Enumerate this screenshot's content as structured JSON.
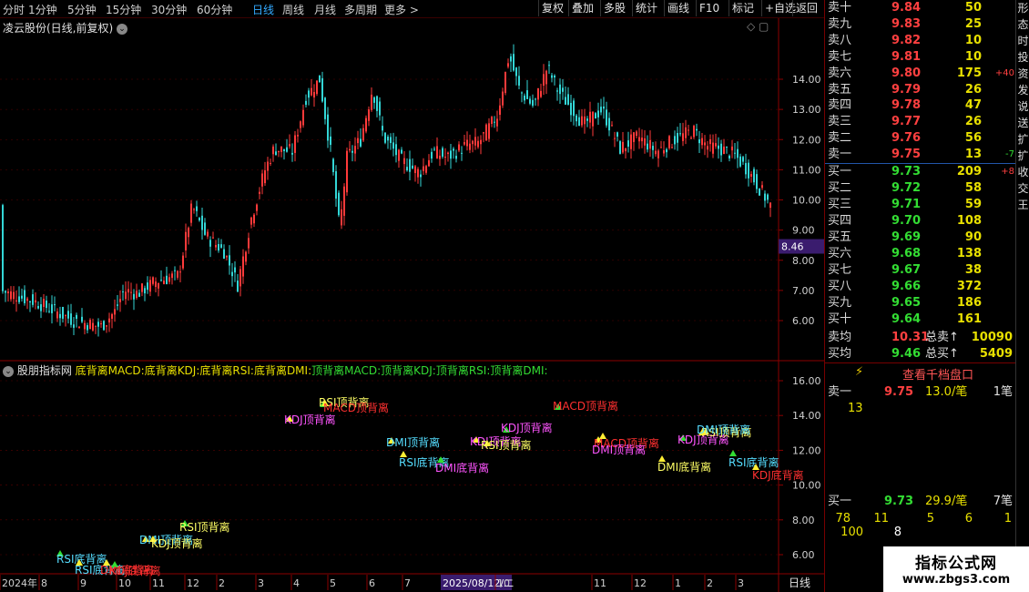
{
  "toolbar": {
    "periods": [
      "分时",
      "1分钟",
      "5分钟",
      "15分钟",
      "30分钟",
      "60分钟",
      "日线",
      "周线",
      "月线",
      "多周期",
      "更多 >"
    ],
    "active_index": 6,
    "right_buttons": [
      "复权",
      "叠加",
      "多股",
      "统计",
      "画线",
      "F10",
      "标记",
      "+自选",
      "返回"
    ]
  },
  "chart_header": {
    "stock_title": "凌云股份(日线,前复权)",
    "current_price_tag": "8.46"
  },
  "indicator_header": {
    "name": "股朋指标网",
    "legend": [
      {
        "text": "底背离MACD:",
        "color": "#e8e000"
      },
      {
        "text": "底背离KDJ:",
        "color": "#e8e000"
      },
      {
        "text": "底背离RSI:",
        "color": "#e8e000"
      },
      {
        "text": "底背离DMI:",
        "color": "#e8e000"
      },
      {
        "text": "顶背离MACD:",
        "color": "#33dd33"
      },
      {
        "text": "顶背离KDJ:",
        "color": "#33dd33"
      },
      {
        "text": "顶背离RSI:",
        "color": "#33dd33"
      },
      {
        "text": "顶背离DMI:",
        "color": "#33dd33"
      }
    ]
  },
  "price_axis": [
    "14.00",
    "13.00",
    "12.00",
    "11.00",
    "10.00",
    "9.00",
    "8.00",
    "7.00",
    "6.00"
  ],
  "indicator_axis": [
    "16.00",
    "14.00",
    "12.00",
    "10.00",
    "8.00",
    "6.00"
  ],
  "date_axis": {
    "labels": [
      "2024年",
      "8",
      "9",
      "10",
      "11",
      "12",
      "2",
      "3",
      "4",
      "5",
      "6",
      "7",
      "2025/08/12/二",
      "10",
      "11",
      "12",
      "1",
      "2",
      "3"
    ],
    "period_label": "日线"
  },
  "divergence_labels": [
    {
      "text": "RSI顶背离",
      "color": "#ffff66"
    },
    {
      "text": "MACD顶背离",
      "color": "#ff3030"
    },
    {
      "text": "KDJ顶背离",
      "color": "#ff55ff"
    },
    {
      "text": "MACD顶背离",
      "color": "#ff3030"
    },
    {
      "text": "DMI顶背离",
      "color": "#55ddff"
    },
    {
      "text": "RSI底背离",
      "color": "#55ddff"
    },
    {
      "text": "DMI底背离",
      "color": "#ff55ff"
    },
    {
      "text": "KDJ顶背离",
      "color": "#ff55ff"
    },
    {
      "text": "RSI顶背离",
      "color": "#ffff66"
    },
    {
      "text": "KDJ顶背离",
      "color": "#ff55ff"
    },
    {
      "text": "MACD顶背离",
      "color": "#ff3030"
    },
    {
      "text": "DMI顶背离",
      "color": "#ff55ff"
    },
    {
      "text": "KDJ顶背离",
      "color": "#ff55ff"
    },
    {
      "text": "RSI顶背离",
      "color": "#ffff66"
    },
    {
      "text": "DMI顶背离",
      "color": "#55ddff"
    },
    {
      "text": "RSI底背离",
      "color": "#55ddff"
    },
    {
      "text": "DMI底背离",
      "color": "#ffff66"
    },
    {
      "text": "KDJ底背离",
      "color": "#ff3030"
    },
    {
      "text": "RSI顶背离",
      "color": "#ffff66"
    },
    {
      "text": "DMI顶背离",
      "color": "#55ddff"
    },
    {
      "text": "KDJ顶背离",
      "color": "#ffff66"
    },
    {
      "text": "RSI底背离",
      "color": "#55ddff"
    },
    {
      "text": "RSI底背离",
      "color": "#55ddff"
    },
    {
      "text": "DMI底背离",
      "color": "#ff3030"
    },
    {
      "text": "KDJ底背离",
      "color": "#ff3030"
    }
  ],
  "quote": {
    "sell": [
      {
        "label": "卖十",
        "price": "9.84",
        "vol": "50",
        "chg": ""
      },
      {
        "label": "卖九",
        "price": "9.83",
        "vol": "25",
        "chg": ""
      },
      {
        "label": "卖八",
        "price": "9.82",
        "vol": "10",
        "chg": ""
      },
      {
        "label": "卖七",
        "price": "9.81",
        "vol": "10",
        "chg": ""
      },
      {
        "label": "卖六",
        "price": "9.80",
        "vol": "175",
        "chg": "+40"
      },
      {
        "label": "卖五",
        "price": "9.79",
        "vol": "26",
        "chg": ""
      },
      {
        "label": "卖四",
        "price": "9.78",
        "vol": "47",
        "chg": ""
      },
      {
        "label": "卖三",
        "price": "9.77",
        "vol": "26",
        "chg": ""
      },
      {
        "label": "卖二",
        "price": "9.76",
        "vol": "56",
        "chg": ""
      },
      {
        "label": "卖一",
        "price": "9.75",
        "vol": "13",
        "chg": "-7"
      }
    ],
    "buy": [
      {
        "label": "买一",
        "price": "9.73",
        "vol": "209",
        "chg": "+8"
      },
      {
        "label": "买二",
        "price": "9.72",
        "vol": "58",
        "chg": ""
      },
      {
        "label": "买三",
        "price": "9.71",
        "vol": "59",
        "chg": ""
      },
      {
        "label": "买四",
        "price": "9.70",
        "vol": "108",
        "chg": ""
      },
      {
        "label": "买五",
        "price": "9.69",
        "vol": "90",
        "chg": ""
      },
      {
        "label": "买六",
        "price": "9.68",
        "vol": "138",
        "chg": ""
      },
      {
        "label": "买七",
        "price": "9.67",
        "vol": "38",
        "chg": ""
      },
      {
        "label": "买八",
        "price": "9.66",
        "vol": "372",
        "chg": ""
      },
      {
        "label": "买九",
        "price": "9.65",
        "vol": "186",
        "chg": ""
      },
      {
        "label": "买十",
        "price": "9.64",
        "vol": "161",
        "chg": ""
      }
    ],
    "avg_sell_label": "卖均",
    "avg_sell": "10.31",
    "total_sell_label": "总卖",
    "total_sell": "10090",
    "avg_buy_label": "买均",
    "avg_buy": "9.46",
    "total_buy_label": "总买",
    "total_buy": "5409",
    "depth_link": "查看千档盘口",
    "sell1_label": "卖一",
    "sell1_price": "9.75",
    "sell1_per": "13.0/笔",
    "sell1_count": "1笔",
    "sell1_queue": "13",
    "buy1_label": "买一",
    "buy1_price": "9.73",
    "buy1_per": "29.9/笔",
    "buy1_count": "7笔",
    "buy1_queue_row1": [
      "78",
      "11",
      "5",
      "6",
      "1"
    ],
    "buy1_queue_row2": [
      "100",
      "8"
    ]
  },
  "side_tabs": [
    "形",
    "态",
    "时",
    "投",
    "资",
    "发",
    "说",
    "送",
    "扩",
    "扩",
    "收",
    "交",
    "王"
  ],
  "watermark": {
    "line1": "指标公式网",
    "line2": "www.zbgs3.com"
  }
}
